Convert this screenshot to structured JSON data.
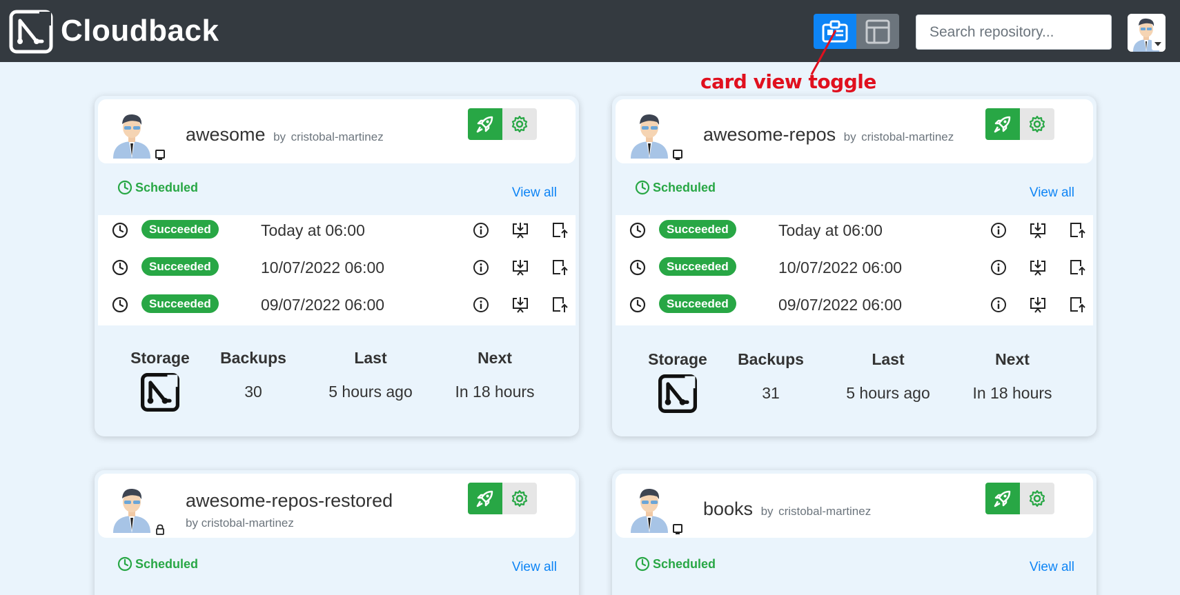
{
  "app": {
    "brand": "Cloudback",
    "search_placeholder": "Search repository..."
  },
  "annotation": {
    "text": "card view toggle",
    "color": "#e0101e"
  },
  "colors": {
    "success": "#28a745",
    "primary": "#0d84f5",
    "topbar": "#343a40"
  },
  "cards": [
    {
      "title": "awesome",
      "by": "by",
      "owner": "cristobal-martinez",
      "type_icon": "monitor-icon",
      "status": "Scheduled",
      "view_all": "View all",
      "backups": [
        {
          "status": "Succeeded",
          "date": "Today at 06:00"
        },
        {
          "status": "Succeeded",
          "date": "10/07/2022 06:00"
        },
        {
          "status": "Succeeded",
          "date": "09/07/2022 06:00"
        }
      ],
      "stats": {
        "storage_label": "Storage",
        "backups_label": "Backups",
        "backups_value": "30",
        "last_label": "Last",
        "last_value": "5 hours ago",
        "next_label": "Next",
        "next_value": "In 18 hours"
      }
    },
    {
      "title": "awesome-repos",
      "by": "by",
      "owner": "cristobal-martinez",
      "type_icon": "monitor-icon",
      "status": "Scheduled",
      "view_all": "View all",
      "backups": [
        {
          "status": "Succeeded",
          "date": "Today at 06:00"
        },
        {
          "status": "Succeeded",
          "date": "10/07/2022 06:00"
        },
        {
          "status": "Succeeded",
          "date": "09/07/2022 06:00"
        }
      ],
      "stats": {
        "storage_label": "Storage",
        "backups_label": "Backups",
        "backups_value": "31",
        "last_label": "Last",
        "last_value": "5 hours ago",
        "next_label": "Next",
        "next_value": "In 18 hours"
      }
    },
    {
      "title": "awesome-repos-restored",
      "by": "by",
      "owner": "cristobal-martinez",
      "type_icon": "lock-icon",
      "status": "Scheduled",
      "view_all": "View all"
    },
    {
      "title": "books",
      "by": "by",
      "owner": "cristobal-martinez",
      "type_icon": "monitor-icon",
      "status": "Scheduled",
      "view_all": "View all"
    }
  ]
}
